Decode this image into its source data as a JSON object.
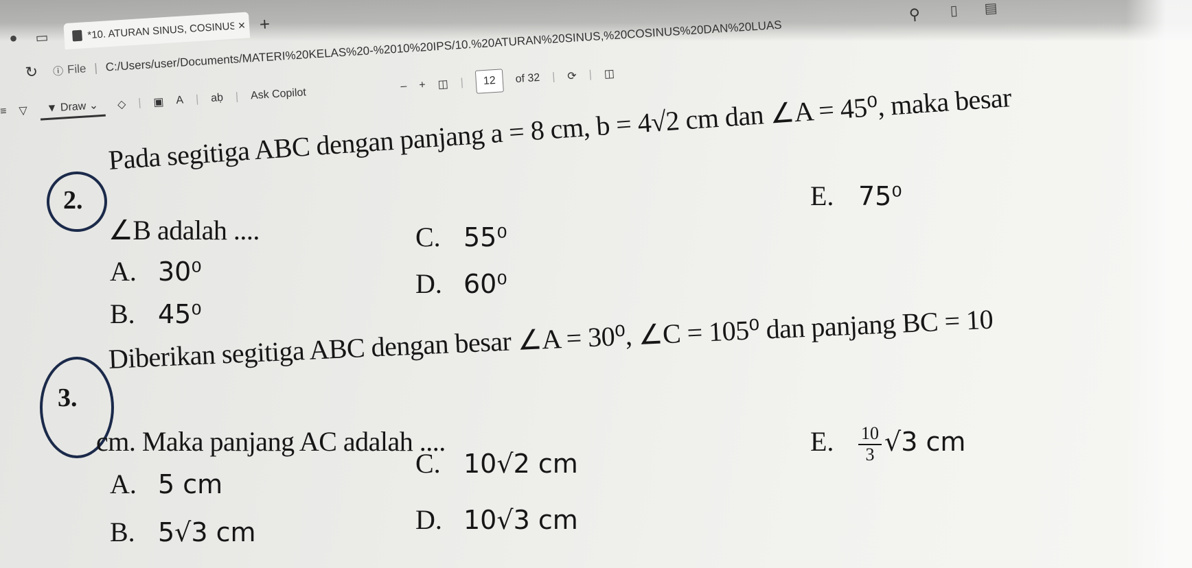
{
  "browser": {
    "tab_title": "*10. ATURAN SINUS, COSINUS D...",
    "tab_close": "×",
    "new_tab": "+",
    "address_file_label": "File",
    "address_url": "C:/Users/user/Documents/MATERI%20KELAS%20-%2010%20IPS/10.%20ATURAN%20SINUS,%20COSINUS%20DAN%20LUAS",
    "icons": {
      "refresh": "refresh-icon",
      "info": "info-icon",
      "search": "search-icon"
    }
  },
  "pdf_toolbar": {
    "draw_label": "Draw",
    "read_aloud_label": "aḅ",
    "ask_copilot_label": "Ask Copilot",
    "zoom_out": "–",
    "zoom_in": "+",
    "page_number": "12",
    "page_total": "of 32"
  },
  "questions": [
    {
      "number": "2.",
      "line1": "Pada segitiga ABC dengan panjang a = 8 cm, b = 4√2 cm dan ∠A = 45⁰, maka besar",
      "line2": "∠B adalah ....",
      "options": [
        {
          "label": "A.",
          "value": "30⁰"
        },
        {
          "label": "B.",
          "value": "45⁰"
        },
        {
          "label": "C.",
          "value": "55⁰"
        },
        {
          "label": "D.",
          "value": "60⁰"
        },
        {
          "label": "E.",
          "value": "75⁰"
        }
      ]
    },
    {
      "number": "3.",
      "line1": "Diberikan segitiga ABC dengan besar ∠A = 30⁰, ∠C = 105⁰ dan panjang BC = 10",
      "line2": "cm. Maka panjang AC adalah ....",
      "options": [
        {
          "label": "A.",
          "value": "5 cm"
        },
        {
          "label": "B.",
          "value": "5√3 cm"
        },
        {
          "label": "C.",
          "value": "10√2 cm"
        },
        {
          "label": "D.",
          "value": "10√3 cm"
        },
        {
          "label": "E.",
          "frac_num": "10",
          "frac_den": "3",
          "value": "√3 cm"
        }
      ]
    }
  ]
}
